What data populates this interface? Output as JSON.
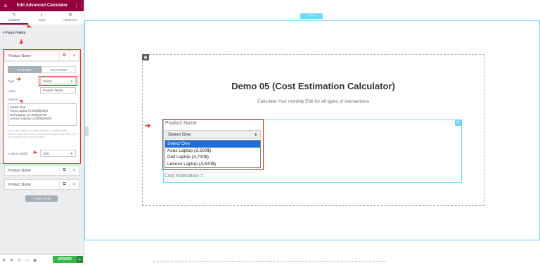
{
  "panel": {
    "title": "Edit Advanced Calculator",
    "tabs": [
      {
        "label": "Content",
        "icon": "pencil-icon"
      },
      {
        "label": "Style",
        "icon": "half-circle-icon"
      },
      {
        "label": "Advanced",
        "icon": "gear-icon"
      }
    ],
    "section_title": "Form Fields",
    "item1": {
      "label": "Product Name",
      "subtabs": [
        "CONTENT",
        "ADVANCED"
      ],
      "type_label": "Type",
      "type_value": "Select",
      "label_label": "Label",
      "label_value": "Product Name",
      "options_label": "Options",
      "options_text": "Select One\nAsus Laptop (3,500$)|3500\nDell Laptop (3,700$)|3700\nLenovo Laptop (4,500$)|4500",
      "help_text": "Enter each option in a separated line. To differentiate between label and value, separate them with a pipe char (\"|\"). For example: First Name|f_name",
      "column_width_label": "Column Width",
      "column_width_value": "33%"
    },
    "item2": {
      "label": "Product Name"
    },
    "item3": {
      "label": "Product Name"
    },
    "add_button": "+ ADD ITEM",
    "update_button": "UPDATE"
  },
  "canvas": {
    "section_handle": "+ ⠿ ×",
    "title": "Demo 05 (Cost Estimation Calculator)",
    "subtitle": "Calculate Your monthly EMI for all types of transactions",
    "field_label": "Product Name",
    "select_value": "Select One",
    "options": [
      "Select One",
      "Asus Laptop (3,500$)",
      "Dell Laptop (3,700$)",
      "Lenovo Laptop (4,500$)"
    ],
    "selected_index": 0,
    "cost_label": "Cost Estimation ="
  },
  "colors": {
    "brand": "#93003c",
    "annotation_red": "#d9362c",
    "editor_blue": "#71d7f7",
    "update_green": "#39b54a",
    "option_highlight": "#1e6fd9"
  }
}
